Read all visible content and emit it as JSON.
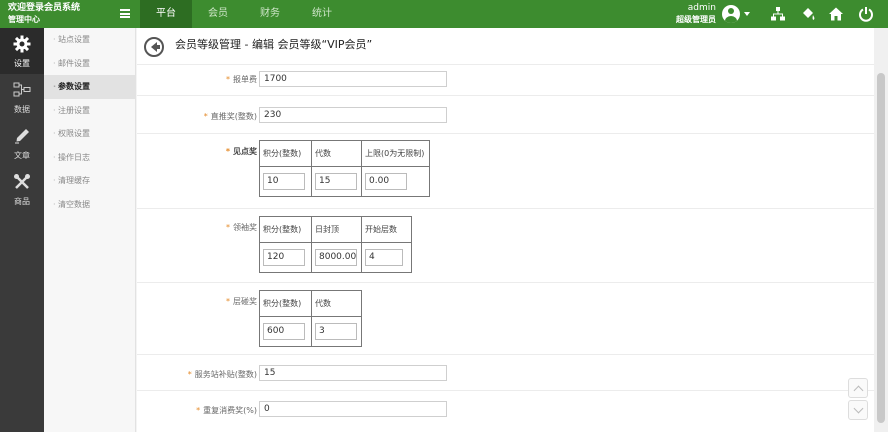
{
  "app": {
    "brand_line1": "欢迎登录会员系统",
    "brand_line2": "管理中心"
  },
  "top_nav": [
    {
      "label": "平台",
      "active": true
    },
    {
      "label": "会员",
      "active": false
    },
    {
      "label": "财务",
      "active": false
    },
    {
      "label": "统计",
      "active": false
    }
  ],
  "user": {
    "name": "admin",
    "role": "超级管理员"
  },
  "sidebar": [
    {
      "label": "设置",
      "icon": "gear-icon",
      "active": true
    },
    {
      "label": "数据",
      "icon": "sitemap-icon",
      "active": false
    },
    {
      "label": "文章",
      "icon": "pen-icon",
      "active": false
    },
    {
      "label": "商品",
      "icon": "tools-icon",
      "active": false
    }
  ],
  "submenu": [
    {
      "label": "站点设置",
      "active": false
    },
    {
      "label": "邮件设置",
      "active": false
    },
    {
      "label": "参数设置",
      "active": true
    },
    {
      "label": "注册设置",
      "active": false
    },
    {
      "label": "权限设置",
      "active": false
    },
    {
      "label": "操作日志",
      "active": false
    },
    {
      "label": "清理缓存",
      "active": false
    },
    {
      "label": "清空数据",
      "active": false
    }
  ],
  "page": {
    "title": "会员等级管理 - 编辑 会员等级“VIP会员”"
  },
  "form": {
    "baodanfei": {
      "label": "报单费",
      "value": "1700"
    },
    "zhituijiang": {
      "label": "直推奖(整数)",
      "value": "230"
    },
    "jiandianjiang": {
      "label": "见点奖",
      "headers": [
        "积分(整数)",
        "代数",
        "上限(0为无限制)"
      ],
      "values": [
        "10",
        "15",
        "0.00"
      ]
    },
    "lingdaojiang": {
      "label": "领袖奖",
      "headers": [
        "积分(整数)",
        "日封顶",
        "开始层数"
      ],
      "values": [
        "120",
        "8000.00",
        "4"
      ]
    },
    "cengjiang": {
      "label": "层碰奖",
      "headers": [
        "积分(整数)",
        "代数"
      ],
      "values": [
        "600",
        "3"
      ]
    },
    "fuwuzhan": {
      "label": "服务站补贴(整数)",
      "value": "15"
    },
    "chongfu": {
      "label": "重复消费奖(%)",
      "value": "0"
    }
  }
}
